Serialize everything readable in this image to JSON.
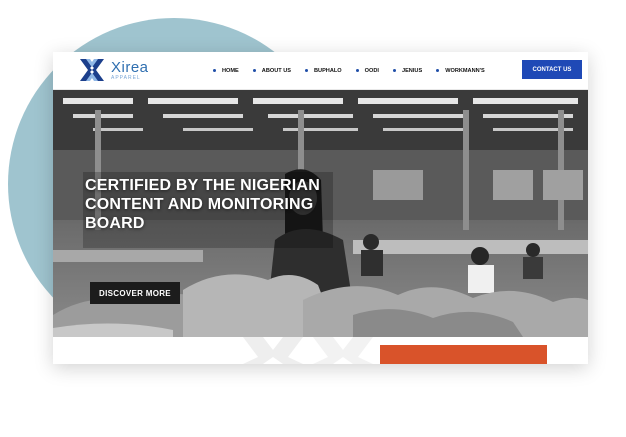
{
  "brand": {
    "name": "Xirea",
    "tagline": "APPAREL",
    "colors": {
      "primary": "#1f49b6",
      "mark_dark": "#1c3f8c",
      "mark_light": "#8fb7e6"
    }
  },
  "nav": {
    "items": [
      {
        "label": "HOME"
      },
      {
        "label": "ABOUT US"
      },
      {
        "label": "BUPHALO"
      },
      {
        "label": "OODI"
      },
      {
        "label": "JENIUS"
      },
      {
        "label": "WORKMANN'S"
      }
    ],
    "cta_label": "CONTACT US"
  },
  "hero": {
    "title": "CERTIFIED BY THE NIGERIAN CONTENT AND MONITORING BOARD",
    "button_label": "DISCOVER MORE",
    "image": "garment-factory-photo"
  },
  "icons": {
    "logo": "x-cross-logo-icon",
    "nav_bullet": "dot-icon"
  }
}
